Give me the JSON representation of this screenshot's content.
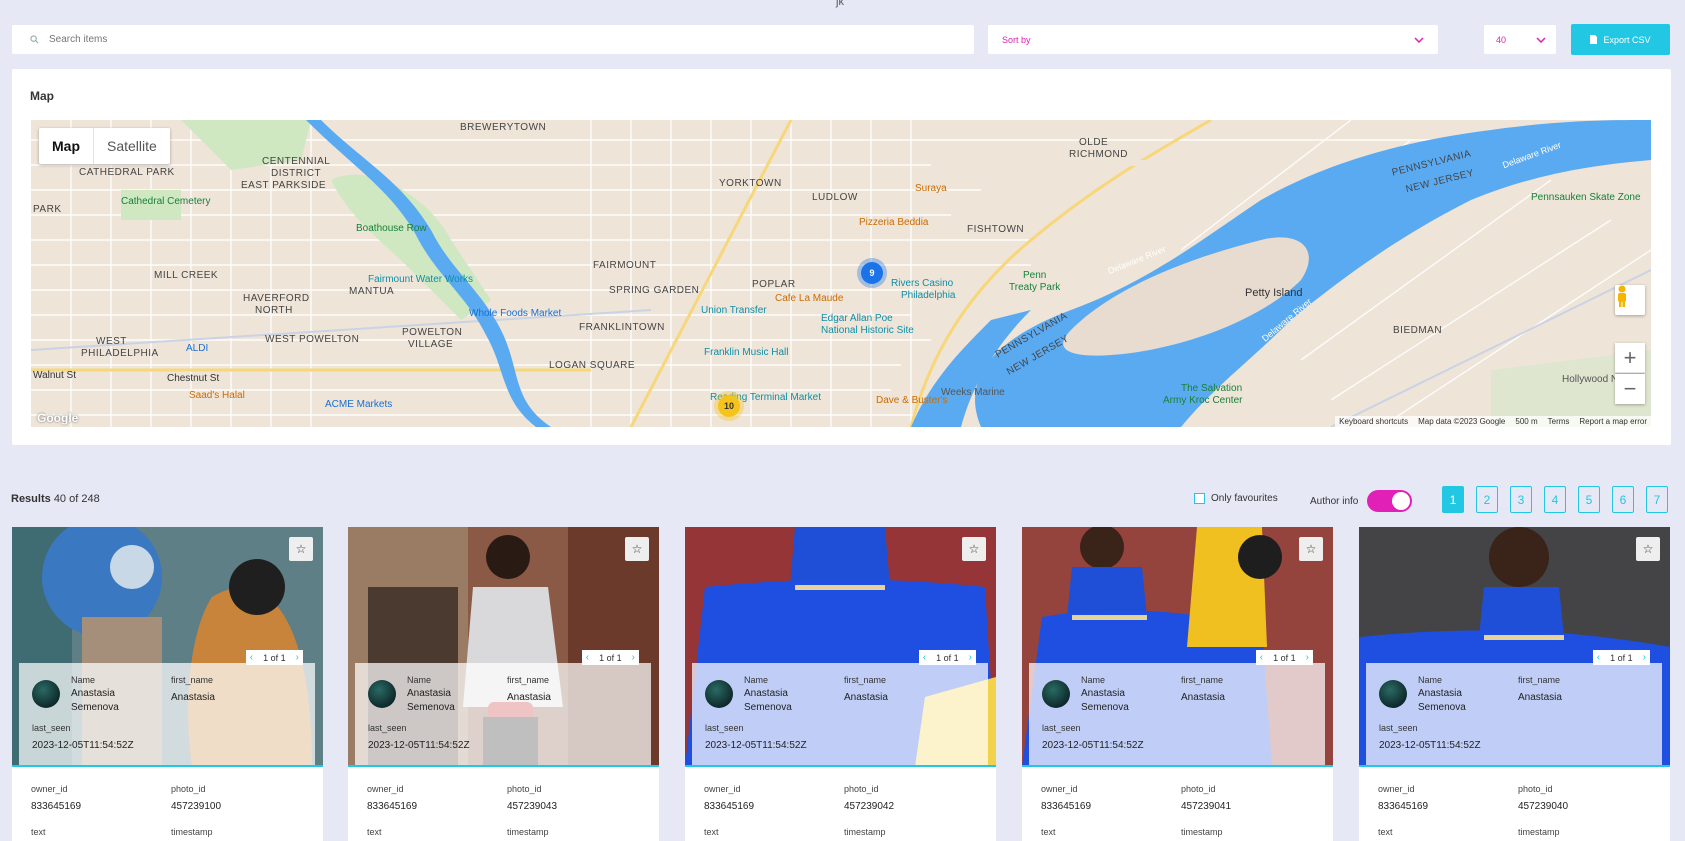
{
  "top_mark": "jk",
  "search": {
    "placeholder": "Search items"
  },
  "sort": {
    "placeholder": "Sort by"
  },
  "per_page": {
    "value": "40"
  },
  "export": {
    "label": "Export CSV"
  },
  "map": {
    "title": "Map",
    "type_map": "Map",
    "type_satellite": "Satellite",
    "attribution": {
      "shortcuts": "Keyboard shortcuts",
      "data": "Map data ©2023 Google",
      "scale": "500 m",
      "terms": "Terms",
      "report": "Report a map error"
    },
    "clusters": [
      {
        "count": "9"
      },
      {
        "count": "10"
      }
    ],
    "labels": {
      "brewerytown": "BREWERYTOWN",
      "cathedral_park": "CATHEDRAL PARK",
      "centennial": "CENTENNIAL",
      "district": "DISTRICT",
      "east_parkside": "EAST PARKSIDE",
      "cathedral_cemetery": "Cathedral Cemetery",
      "park": "PARK",
      "boathouse_row": "Boathouse Row",
      "mill_creek": "MILL CREEK",
      "haverford": "HAVERFORD",
      "north": "NORTH",
      "mantua": "MANTUA",
      "fairmount_water_works": "Fairmount Water Works",
      "whole_foods": "Whole Foods Market",
      "west": "WEST",
      "philadelphia": "PHILADELPHIA",
      "aldi": "ALDI",
      "west_powelton": "WEST POWELTON",
      "powelton": "POWELTON",
      "village": "VILLAGE",
      "walnut_st": "Walnut St",
      "chestnut_st": "Chestnut St",
      "saads_halal": "Saad's Halal",
      "acme": "ACME Markets",
      "fairmount": "FAIRMOUNT",
      "spring_garden": "SPRING GARDEN",
      "franklintown": "FRANKLINTOWN",
      "logan_square": "LOGAN SQUARE",
      "yorktown": "YORKTOWN",
      "ludlow": "LUDLOW",
      "poplar": "POPLAR",
      "cafe_la_maude": "Cafe La Maude",
      "union_transfer": "Union Transfer",
      "edgar_allan_poe": "Edgar Allan Poe",
      "national_historic_site": "National Historic Site",
      "franklin_music_hall": "Franklin Music Hall",
      "reading_terminal": "Reading Terminal Market",
      "suraya": "Suraya",
      "pizzeria_beddia": "Pizzeria Beddia",
      "fishtown": "FISHTOWN",
      "olde": "OLDE",
      "richmond": "RICHMOND",
      "rivers_casino": "Rivers Casino",
      "philadelphia_poi": "Philadelphia",
      "penn_treaty": "Penn",
      "treaty_park": "Treaty Park",
      "dave_busters": "Dave & Buster's",
      "weeks_marine": "Weeks Marine",
      "pennsylvania_1": "PENNSYLVANIA",
      "new_jersey_1": "NEW JERSEY",
      "pennsylvania_2": "PENNSYLVANIA",
      "new_jersey_2": "NEW JERSEY",
      "delaware_river_1": "Delaware River",
      "delaware_river_2": "Delaware River",
      "delaware_river_3": "Delaware River",
      "petty_island": "Petty Island",
      "pennsauken": "Pennsauken Skate Zone",
      "biedman": "BIEDMAN",
      "salvation_army": "The Salvation",
      "salvation_army_2": "Army Kroc Center",
      "hollywood_nails": "Hollywood Nails"
    }
  },
  "results": {
    "label": "Results",
    "count": "40 of 248"
  },
  "only_favourites": "Only favourites",
  "author_info": "Author info",
  "pages": [
    "1",
    "2",
    "3",
    "4",
    "5",
    "6",
    "7"
  ],
  "card_labels": {
    "name": "Name",
    "first_name": "first_name",
    "last_seen": "last_seen",
    "owner_id": "owner_id",
    "photo_id": "photo_id",
    "text": "text",
    "timestamp": "timestamp"
  },
  "cards": [
    {
      "slide": "1 of 1",
      "name_line1": "Anastasia",
      "name_line2": "Semenova",
      "first_name": "Anastasia",
      "last_seen": "2023-12-05T11:54:52Z",
      "owner_id": "833645169",
      "photo_id": "457239100"
    },
    {
      "slide": "1 of 1",
      "name_line1": "Anastasia",
      "name_line2": "Semenova",
      "first_name": "Anastasia",
      "last_seen": "2023-12-05T11:54:52Z",
      "owner_id": "833645169",
      "photo_id": "457239043"
    },
    {
      "slide": "1 of 1",
      "name_line1": "Anastasia",
      "name_line2": "Semenova",
      "first_name": "Anastasia",
      "last_seen": "2023-12-05T11:54:52Z",
      "owner_id": "833645169",
      "photo_id": "457239042"
    },
    {
      "slide": "1 of 1",
      "name_line1": "Anastasia",
      "name_line2": "Semenova",
      "first_name": "Anastasia",
      "last_seen": "2023-12-05T11:54:52Z",
      "owner_id": "833645169",
      "photo_id": "457239041"
    },
    {
      "slide": "1 of 1",
      "name_line1": "Anastasia",
      "name_line2": "Semenova",
      "first_name": "Anastasia",
      "last_seen": "2023-12-05T11:54:52Z",
      "owner_id": "833645169",
      "photo_id": "457239040"
    }
  ],
  "colors": {
    "accent": "#22c7e3",
    "magenta": "#e020b6",
    "background": "#e6e8f5"
  }
}
